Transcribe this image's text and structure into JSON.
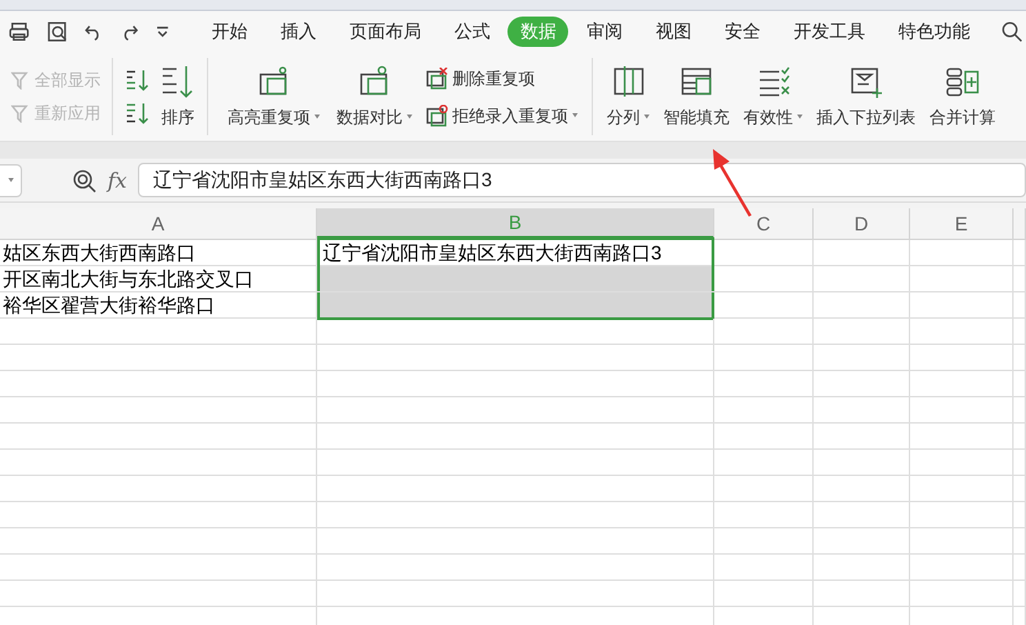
{
  "tabs": [
    {
      "label": "开始",
      "selected": false
    },
    {
      "label": "插入",
      "selected": false
    },
    {
      "label": "页面布局",
      "selected": false
    },
    {
      "label": "公式",
      "selected": false
    },
    {
      "label": "数据",
      "selected": true
    },
    {
      "label": "审阅",
      "selected": false
    },
    {
      "label": "视图",
      "selected": false
    },
    {
      "label": "安全",
      "selected": false
    },
    {
      "label": "开发工具",
      "selected": false
    },
    {
      "label": "特色功能",
      "selected": false
    }
  ],
  "filter_buttons": [
    {
      "label": "全部显示",
      "disabled": true
    },
    {
      "label": "重新应用",
      "disabled": true
    }
  ],
  "sort_button": {
    "label": "排序"
  },
  "large_buttons_1": [
    {
      "label": "高亮重复项",
      "menu": true
    },
    {
      "label": "数据对比",
      "menu": true
    }
  ],
  "small_buttons": [
    {
      "label": "删除重复项",
      "menu": false
    },
    {
      "label": "拒绝录入重复项",
      "menu": true
    }
  ],
  "large_buttons_2": [
    {
      "label": "分列",
      "menu": true
    },
    {
      "label": "智能填充",
      "menu": false
    },
    {
      "label": "有效性",
      "menu": true
    },
    {
      "label": "插入下拉列表",
      "menu": false
    },
    {
      "label": "合并计算",
      "menu": false
    }
  ],
  "formula_bar": {
    "fx_label": "fx",
    "value": "辽宁省沈阳市皇姑区东西大街西南路口3"
  },
  "columns": [
    {
      "label": "A",
      "selected": false
    },
    {
      "label": "B",
      "selected": true
    },
    {
      "label": "C",
      "selected": false
    },
    {
      "label": "D",
      "selected": false
    },
    {
      "label": "E",
      "selected": false
    }
  ],
  "rows": [
    {
      "cells": [
        {
          "text": "姑区东西大街西南路口",
          "selected": false
        },
        {
          "text": "辽宁省沈阳市皇姑区东西大街西南路口3",
          "selected": true,
          "active": true
        }
      ]
    },
    {
      "cells": [
        {
          "text": "开区南北大街与东北路交叉口",
          "selected": false
        },
        {
          "selected": true,
          "active": false
        }
      ]
    },
    {
      "cells": [
        {
          "text": "裕华区翟营大街裕华路口",
          "selected": false
        },
        {
          "selected": true,
          "active": false
        }
      ]
    }
  ]
}
